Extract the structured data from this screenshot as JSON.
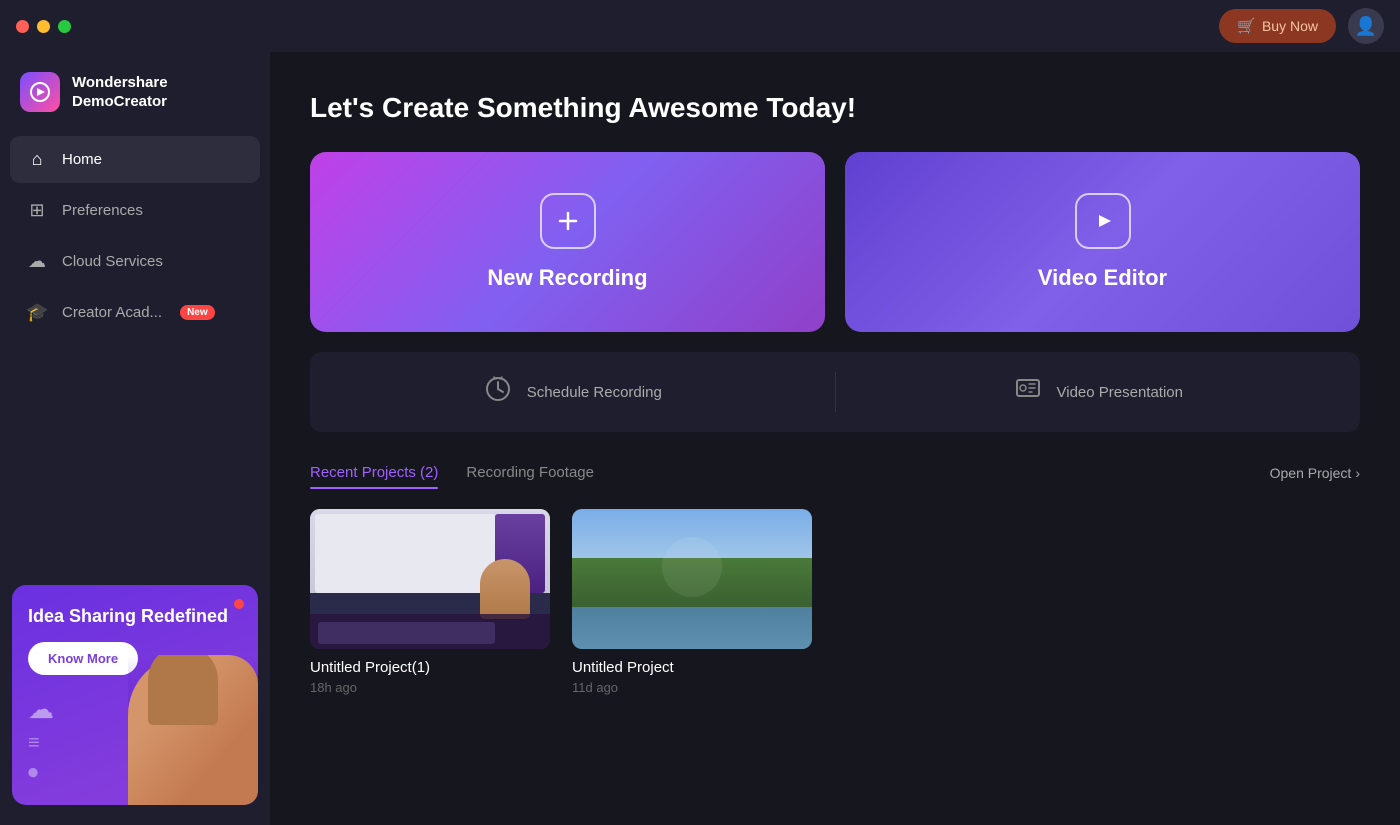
{
  "titlebar": {
    "buy_now_label": "Buy Now",
    "cart_icon": "🛒"
  },
  "sidebar": {
    "logo_text": "Wondershare\nDemoCreator",
    "nav_items": [
      {
        "id": "home",
        "label": "Home",
        "icon": "⌂",
        "active": true
      },
      {
        "id": "preferences",
        "label": "Preferences",
        "icon": "⊞",
        "active": false
      },
      {
        "id": "cloud-services",
        "label": "Cloud Services",
        "icon": "☁",
        "active": false
      },
      {
        "id": "creator-academy",
        "label": "Creator Acad...",
        "icon": "🎓",
        "active": false,
        "badge": "New"
      }
    ],
    "promo": {
      "title": "Idea Sharing Redefined",
      "button_label": "Know More"
    }
  },
  "main": {
    "page_title": "Let's Create Something Awesome Today!",
    "hero_cards": [
      {
        "id": "new-recording",
        "label": "New Recording",
        "icon": "+"
      },
      {
        "id": "video-editor",
        "label": "Video Editor",
        "icon": "▶"
      }
    ],
    "tools": [
      {
        "id": "schedule-recording",
        "label": "Schedule Recording",
        "icon": "⏰"
      },
      {
        "id": "video-presentation",
        "label": "Video Presentation",
        "icon": "📽"
      }
    ],
    "tabs": [
      {
        "id": "recent-projects",
        "label": "Recent Projects (2)",
        "active": true
      },
      {
        "id": "recording-footage",
        "label": "Recording Footage",
        "active": false
      }
    ],
    "open_project_label": "Open Project",
    "projects": [
      {
        "id": "project-1",
        "name": "Untitled Project(1)",
        "time": "18h ago"
      },
      {
        "id": "project-2",
        "name": "Untitled Project",
        "time": "11d ago"
      }
    ]
  }
}
